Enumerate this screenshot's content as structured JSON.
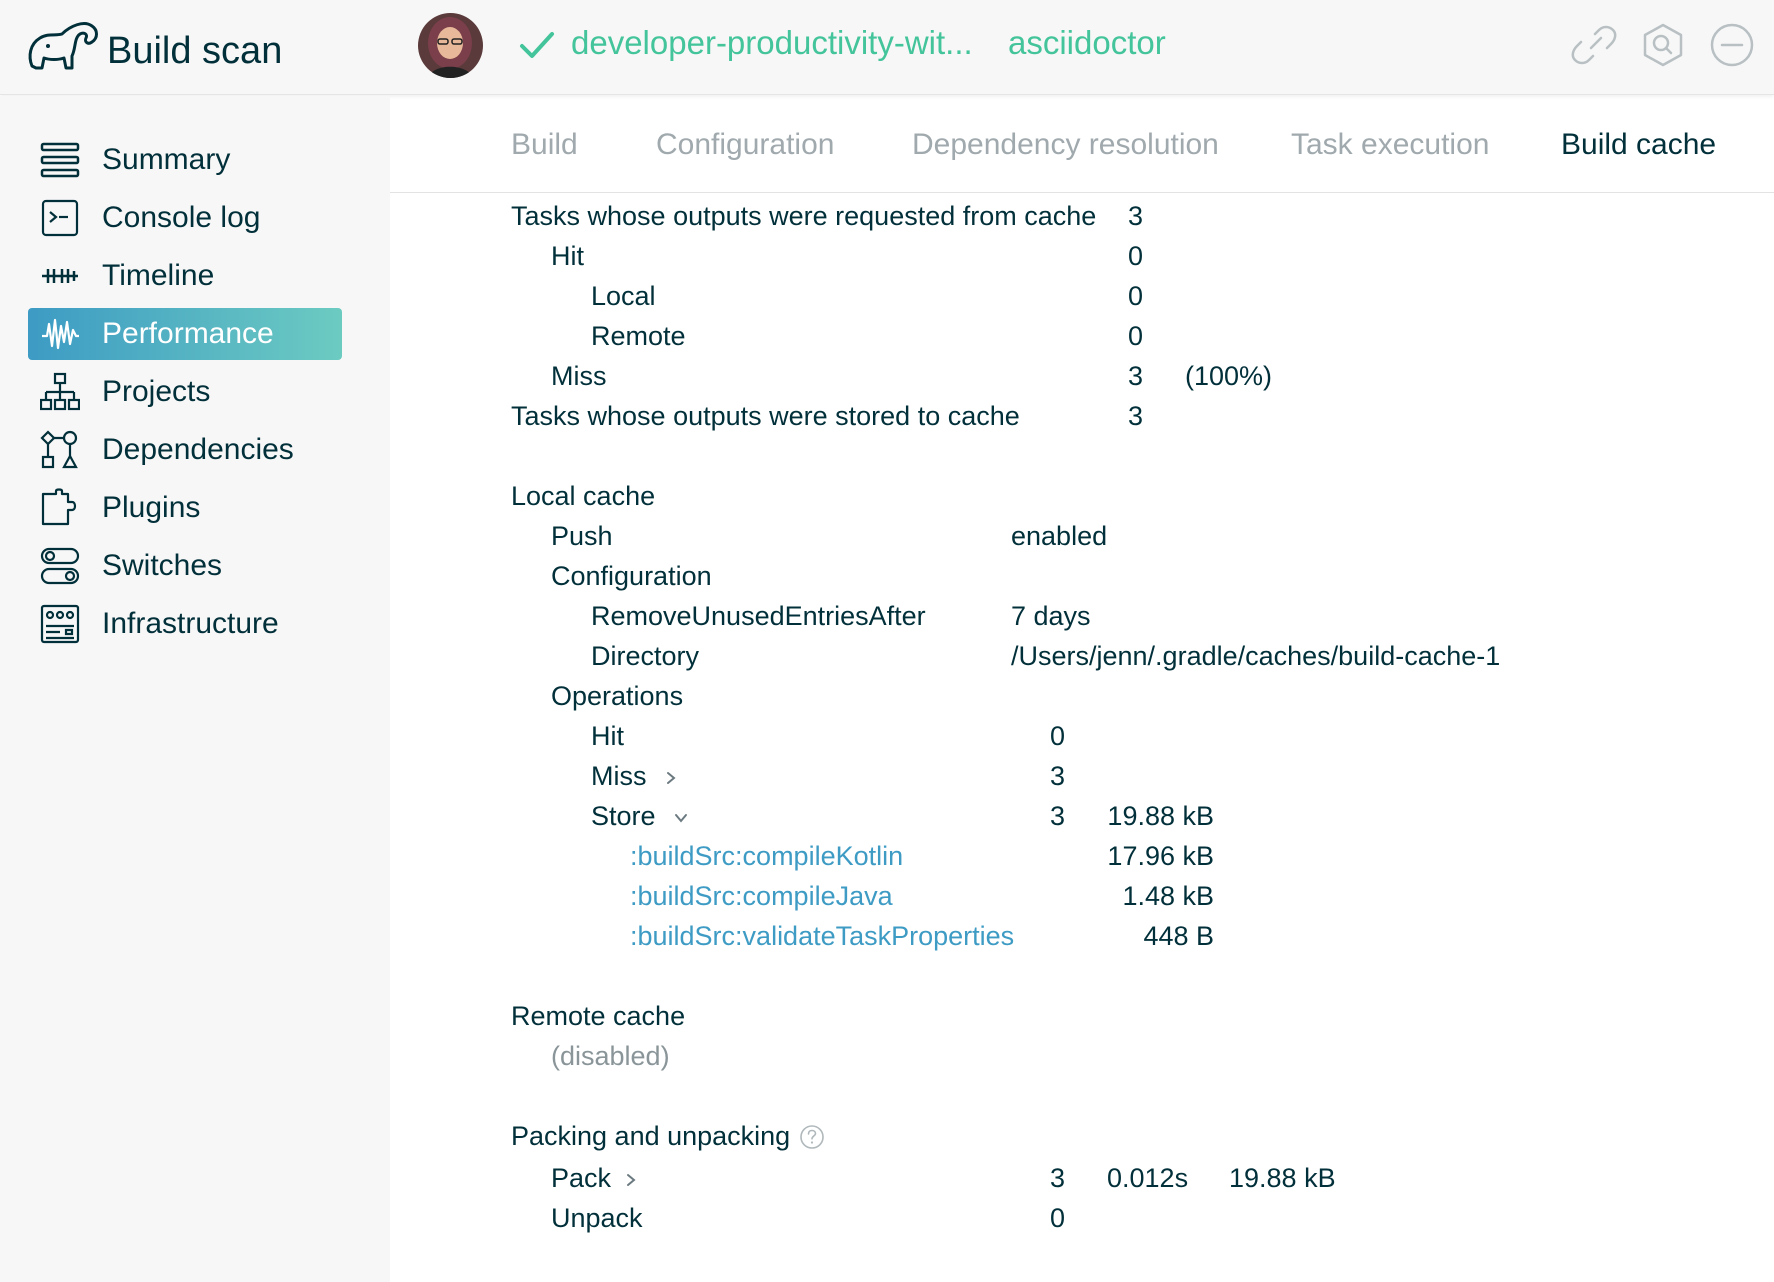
{
  "header": {
    "brand": "Build scan",
    "project": "developer-productivity-wit...",
    "project_secondary": "asciidoctor",
    "icons": [
      "elephant-logo",
      "avatar",
      "check-icon",
      "link-icon",
      "search-icon",
      "minus-circle-icon"
    ],
    "accent_color": "#43c49a"
  },
  "sidebar": {
    "items": [
      {
        "label": "Summary",
        "icon": "summary-icon"
      },
      {
        "label": "Console log",
        "icon": "console-icon"
      },
      {
        "label": "Timeline",
        "icon": "timeline-icon"
      },
      {
        "label": "Performance",
        "icon": "performance-icon",
        "active": true
      },
      {
        "label": "Projects",
        "icon": "projects-icon"
      },
      {
        "label": "Dependencies",
        "icon": "dependencies-icon"
      },
      {
        "label": "Plugins",
        "icon": "plugins-icon"
      },
      {
        "label": "Switches",
        "icon": "switches-icon"
      },
      {
        "label": "Infrastructure",
        "icon": "infrastructure-icon"
      }
    ]
  },
  "tabs": [
    {
      "label": "Build"
    },
    {
      "label": "Configuration"
    },
    {
      "label": "Dependency resolution"
    },
    {
      "label": "Task execution"
    },
    {
      "label": "Build cache",
      "active": true
    }
  ],
  "summary": {
    "requested_label": "Tasks whose outputs were requested from cache",
    "requested_value": "3",
    "hit_label": "Hit",
    "hit_value": "0",
    "local_label": "Local",
    "local_value": "0",
    "remote_label": "Remote",
    "remote_value": "0",
    "miss_label": "Miss",
    "miss_value": "3",
    "miss_pct": "(100%)",
    "stored_label": "Tasks whose outputs were stored to cache",
    "stored_value": "3"
  },
  "local_cache": {
    "title": "Local cache",
    "push_label": "Push",
    "push_value": "enabled",
    "configuration_label": "Configuration",
    "remove_label": "RemoveUnusedEntriesAfter",
    "remove_value": "7 days",
    "directory_label": "Directory",
    "directory_value": "/Users/jenn/.gradle/caches/build-cache-1",
    "operations_label": "Operations",
    "op_hit_label": "Hit",
    "op_hit_value": "0",
    "op_miss_label": "Miss",
    "op_miss_value": "3",
    "op_store_label": "Store",
    "op_store_value": "3",
    "op_store_size": "19.88 kB",
    "store_tasks": [
      {
        "name": ":buildSrc:compileKotlin",
        "size": "17.96 kB"
      },
      {
        "name": ":buildSrc:compileJava",
        "size": "1.48 kB"
      },
      {
        "name": ":buildSrc:validateTaskProperties",
        "size": "448 B"
      }
    ]
  },
  "remote_cache": {
    "title": "Remote cache",
    "status": "(disabled)"
  },
  "packing": {
    "title": "Packing and unpacking",
    "pack_label": "Pack",
    "pack_count": "3",
    "pack_time": "0.012s",
    "pack_size": "19.88 kB",
    "unpack_label": "Unpack",
    "unpack_count": "0"
  }
}
